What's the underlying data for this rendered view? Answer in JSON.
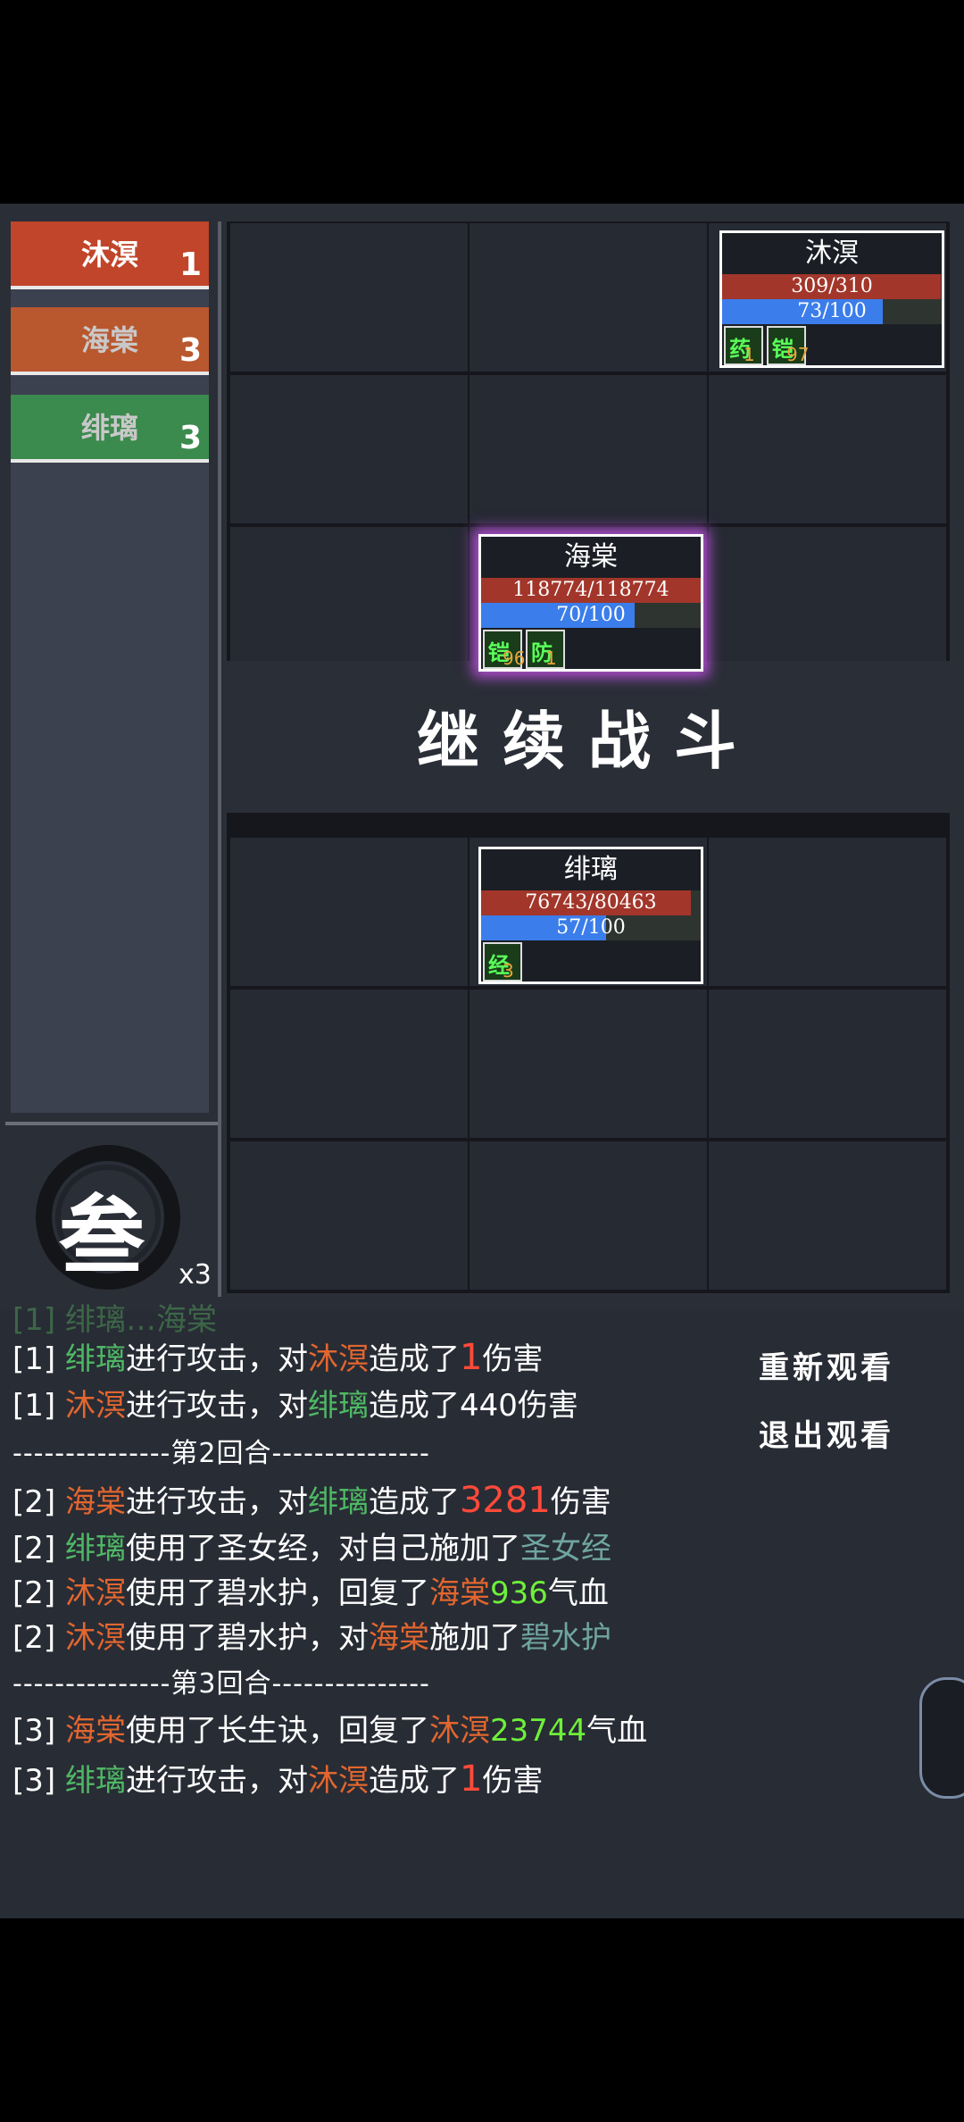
{
  "turn_order": [
    {
      "name": "沐溟",
      "count": "1",
      "color": "#c1452a"
    },
    {
      "name": "海棠",
      "count": "3",
      "color": "#b9572e"
    },
    {
      "name": "绯璃",
      "count": "3",
      "color": "#3b8a4e"
    }
  ],
  "round": {
    "char": "叁",
    "speed": "x3"
  },
  "banner": "继续战斗",
  "units": {
    "muming": {
      "name": "沐溟",
      "hp": "309/310",
      "hp_ratio": 0.997,
      "mp": "73/100",
      "mp_ratio": 0.73,
      "buffs": [
        {
          "char": "药",
          "num": "1"
        },
        {
          "char": "铠",
          "num": "97"
        }
      ]
    },
    "haitang": {
      "name": "海棠",
      "hp": "118774/118774",
      "hp_ratio": 1.0,
      "mp": "70/100",
      "mp_ratio": 0.7,
      "buffs": [
        {
          "char": "铠",
          "num": "96"
        },
        {
          "char": "防",
          "num": "1"
        }
      ]
    },
    "feili": {
      "name": "绯璃",
      "hp": "76743/80463",
      "hp_ratio": 0.954,
      "mp": "57/100",
      "mp_ratio": 0.57,
      "buffs": [
        {
          "char": "经",
          "num": "3"
        }
      ]
    }
  },
  "log": {
    "line0": {
      "t1": "[1] ",
      "t2": "绯璃",
      "t3": "…",
      "t4": "海棠"
    },
    "line1": {
      "p": "[1] ",
      "a": "绯璃",
      "b": "进行攻击，对",
      "c": "沐溟",
      "d": "造成了",
      "e": "1",
      "f": "伤害"
    },
    "line2": {
      "p": "[1] ",
      "a": "沐溟",
      "b": "进行攻击，对",
      "c": "绯璃",
      "d": "造成了440伤害"
    },
    "div2": "---------------第2回合---------------",
    "line3": {
      "p": "[2] ",
      "a": "海棠",
      "b": "进行攻击，对",
      "c": "绯璃",
      "d": "造成了",
      "e": "3281",
      "f": "伤害"
    },
    "line4": {
      "p": "[2] ",
      "a": "绯璃",
      "b": "使用了圣女经，对自己施加了",
      "c": "圣女经"
    },
    "line5": {
      "p": "[2] ",
      "a": "沐溟",
      "b": "使用了碧水护，回复了",
      "c": "海棠",
      "d": "936",
      "e": "气血"
    },
    "line6": {
      "p": "[2] ",
      "a": "沐溟",
      "b": "使用了碧水护，对",
      "c": "海棠",
      "d": "施加了",
      "e": "碧水护"
    },
    "div3": "---------------第3回合---------------",
    "line7": {
      "p": "[3] ",
      "a": "海棠",
      "b": "使用了长生诀，回复了",
      "c": "沐溟",
      "d": "23744",
      "e": "气血"
    },
    "line8": {
      "p": "[3] ",
      "a": "绯璃",
      "b": "进行攻击，对",
      "c": "沐溟",
      "d": "造成了",
      "e": "1",
      "f": "伤害"
    }
  },
  "actions": {
    "replay": "重新观看",
    "exit": "退出观看"
  }
}
